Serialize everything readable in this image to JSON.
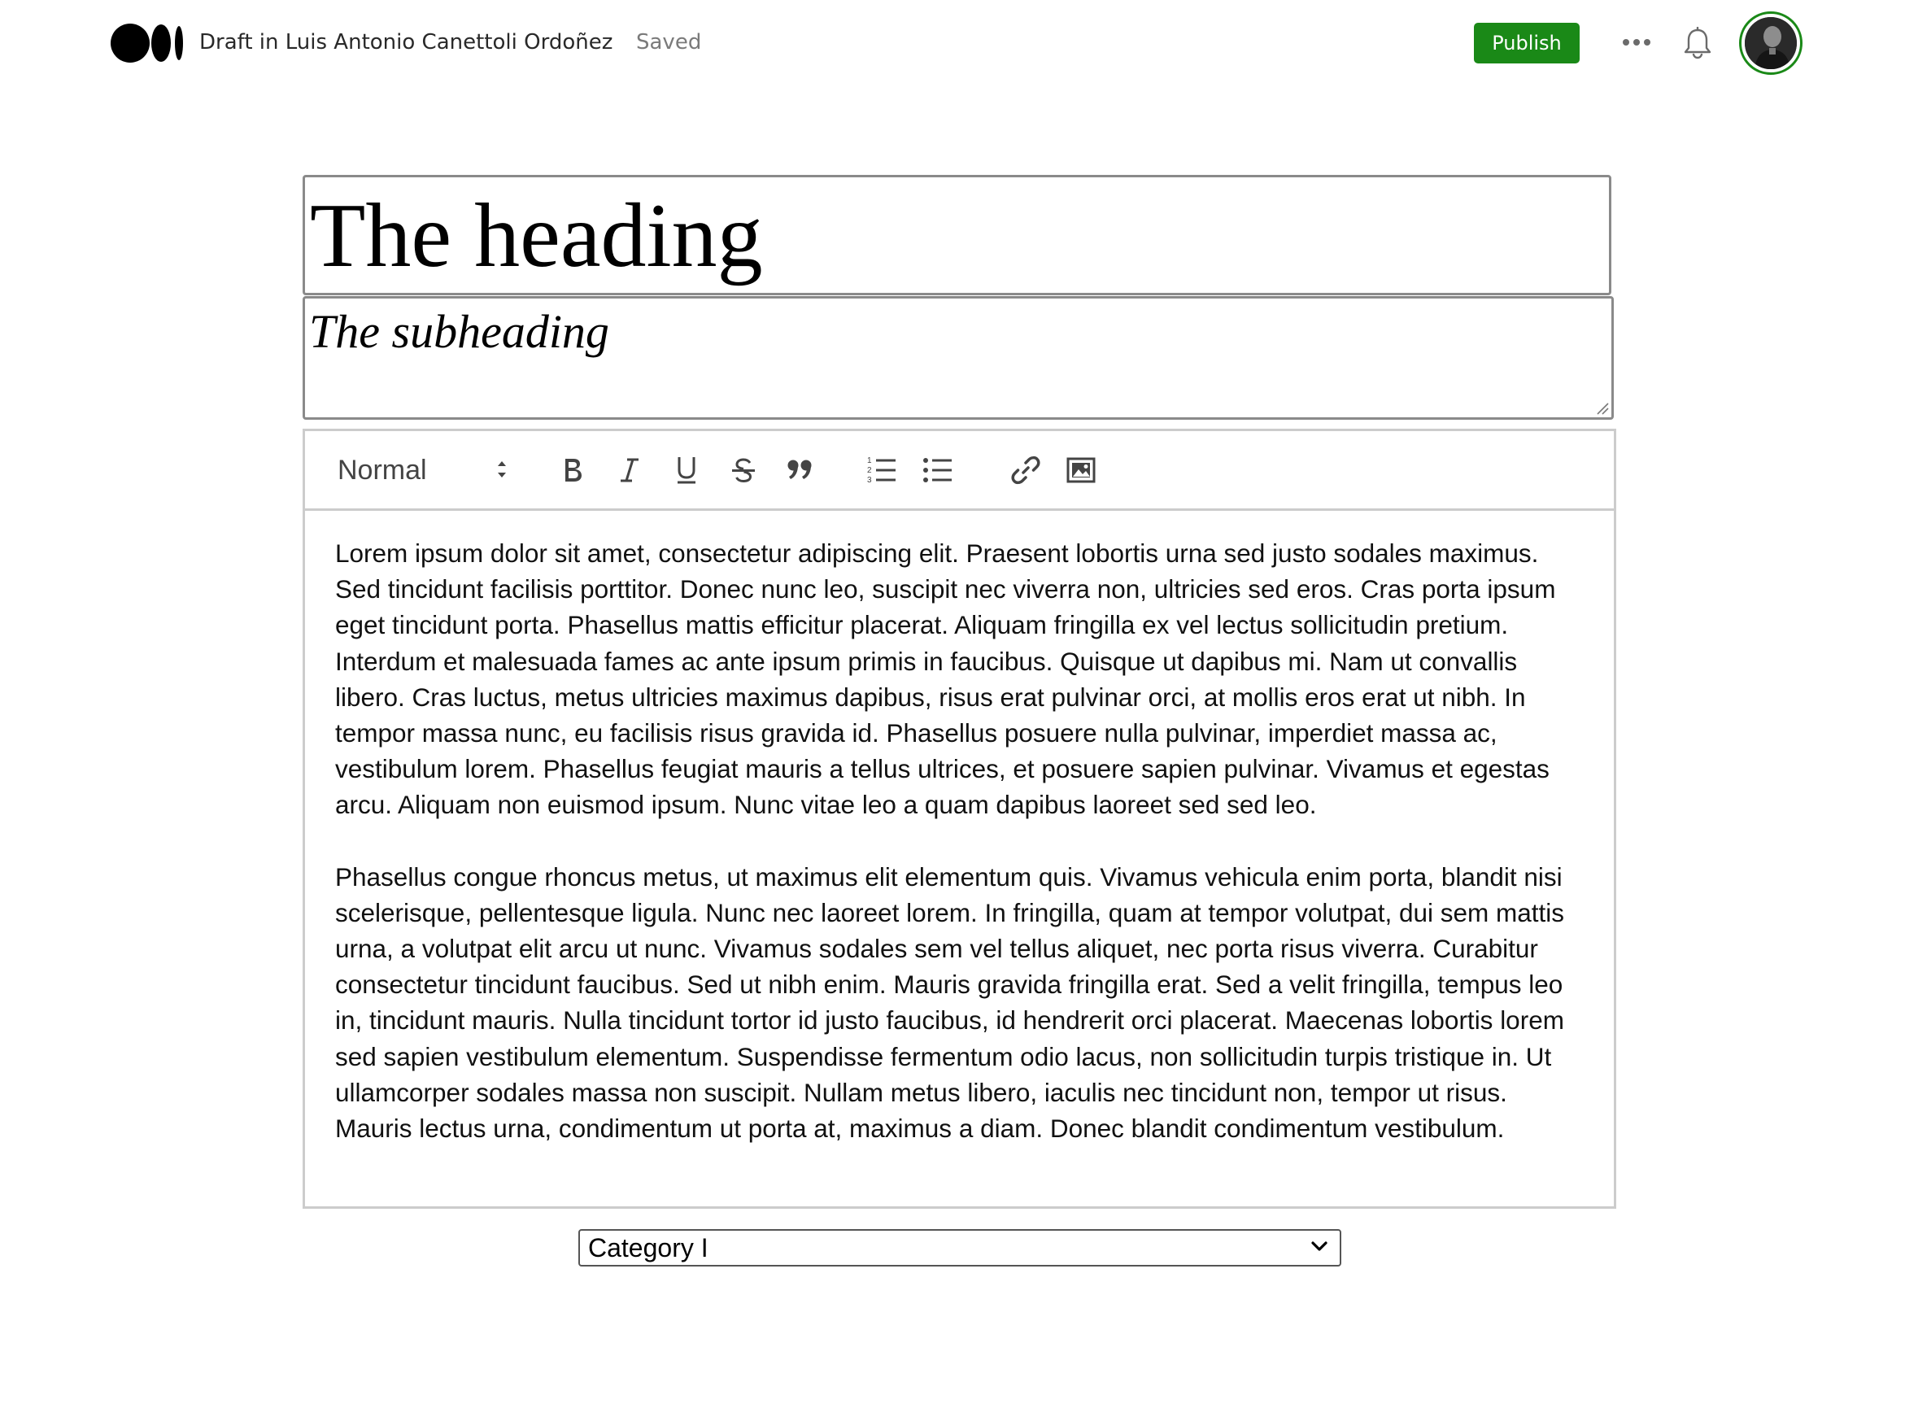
{
  "topbar": {
    "draft_title": "Draft in Luis Antonio Canettoli Ordoñez",
    "status": "Saved",
    "publish_label": "Publish",
    "more_icon": "more-horizontal-icon",
    "notification_icon": "bell-icon",
    "avatar": "user-avatar"
  },
  "editor": {
    "heading": "The heading",
    "subheading": "The subheading",
    "toolbar": {
      "format_value": "Normal",
      "buttons": [
        {
          "name": "bold",
          "glyph": "B"
        },
        {
          "name": "italic",
          "glyph": "I"
        },
        {
          "name": "underline",
          "glyph": "U"
        },
        {
          "name": "strikethrough",
          "glyph": "S"
        },
        {
          "name": "blockquote",
          "icon": "quote-icon"
        },
        {
          "name": "ordered-list",
          "icon": "ordered-list-icon"
        },
        {
          "name": "bullet-list",
          "icon": "bullet-list-icon"
        },
        {
          "name": "link",
          "icon": "link-icon"
        },
        {
          "name": "image",
          "icon": "image-icon"
        }
      ]
    },
    "paragraphs": [
      "Lorem ipsum dolor sit amet, consectetur adipiscing elit. Praesent lobortis urna sed justo sodales maximus. Sed tincidunt facilisis porttitor. Donec nunc leo, suscipit nec viverra non, ultricies sed eros. Cras porta ipsum eget tincidunt porta. Phasellus mattis efficitur placerat. Aliquam fringilla ex vel lectus sollicitudin pretium. Interdum et malesuada fames ac ante ipsum primis in faucibus. Quisque ut dapibus mi. Nam ut convallis libero. Cras luctus, metus ultricies maximus dapibus, risus erat pulvinar orci, at mollis eros erat ut nibh. In tempor massa nunc, eu facilisis risus gravida id. Phasellus posuere nulla pulvinar, imperdiet massa ac, vestibulum lorem. Phasellus feugiat mauris a tellus ultrices, et posuere sapien pulvinar. Vivamus et egestas arcu. Aliquam non euismod ipsum. Nunc vitae leo a quam dapibus laoreet sed sed leo.",
      "Phasellus congue rhoncus metus, ut maximus elit elementum quis. Vivamus vehicula enim porta, blandit nisi scelerisque, pellentesque ligula. Nunc nec laoreet lorem. In fringilla, quam at tempor volutpat, dui sem mattis urna, a volutpat elit arcu ut nunc. Vivamus sodales sem vel tellus aliquet, nec porta risus viverra. Curabitur consectetur tincidunt faucibus. Sed ut nibh enim. Mauris gravida fringilla erat. Sed a velit fringilla, tempus leo in, tincidunt mauris. Nulla tincidunt tortor id justo faucibus, id hendrerit orci placerat. Maecenas lobortis lorem sed sapien vestibulum elementum. Suspendisse fermentum odio lacus, non sollicitudin turpis tristique in. Ut ullamcorper sodales massa non suscipit. Nullam metus libero, iaculis nec tincidunt non, tempor ut risus. Mauris lectus urna, condimentum ut porta at, maximus a diam. Donec blandit condimentum vestibulum."
    ]
  },
  "category": {
    "selected": "Category I"
  },
  "colors": {
    "accent": "#1a8917"
  }
}
